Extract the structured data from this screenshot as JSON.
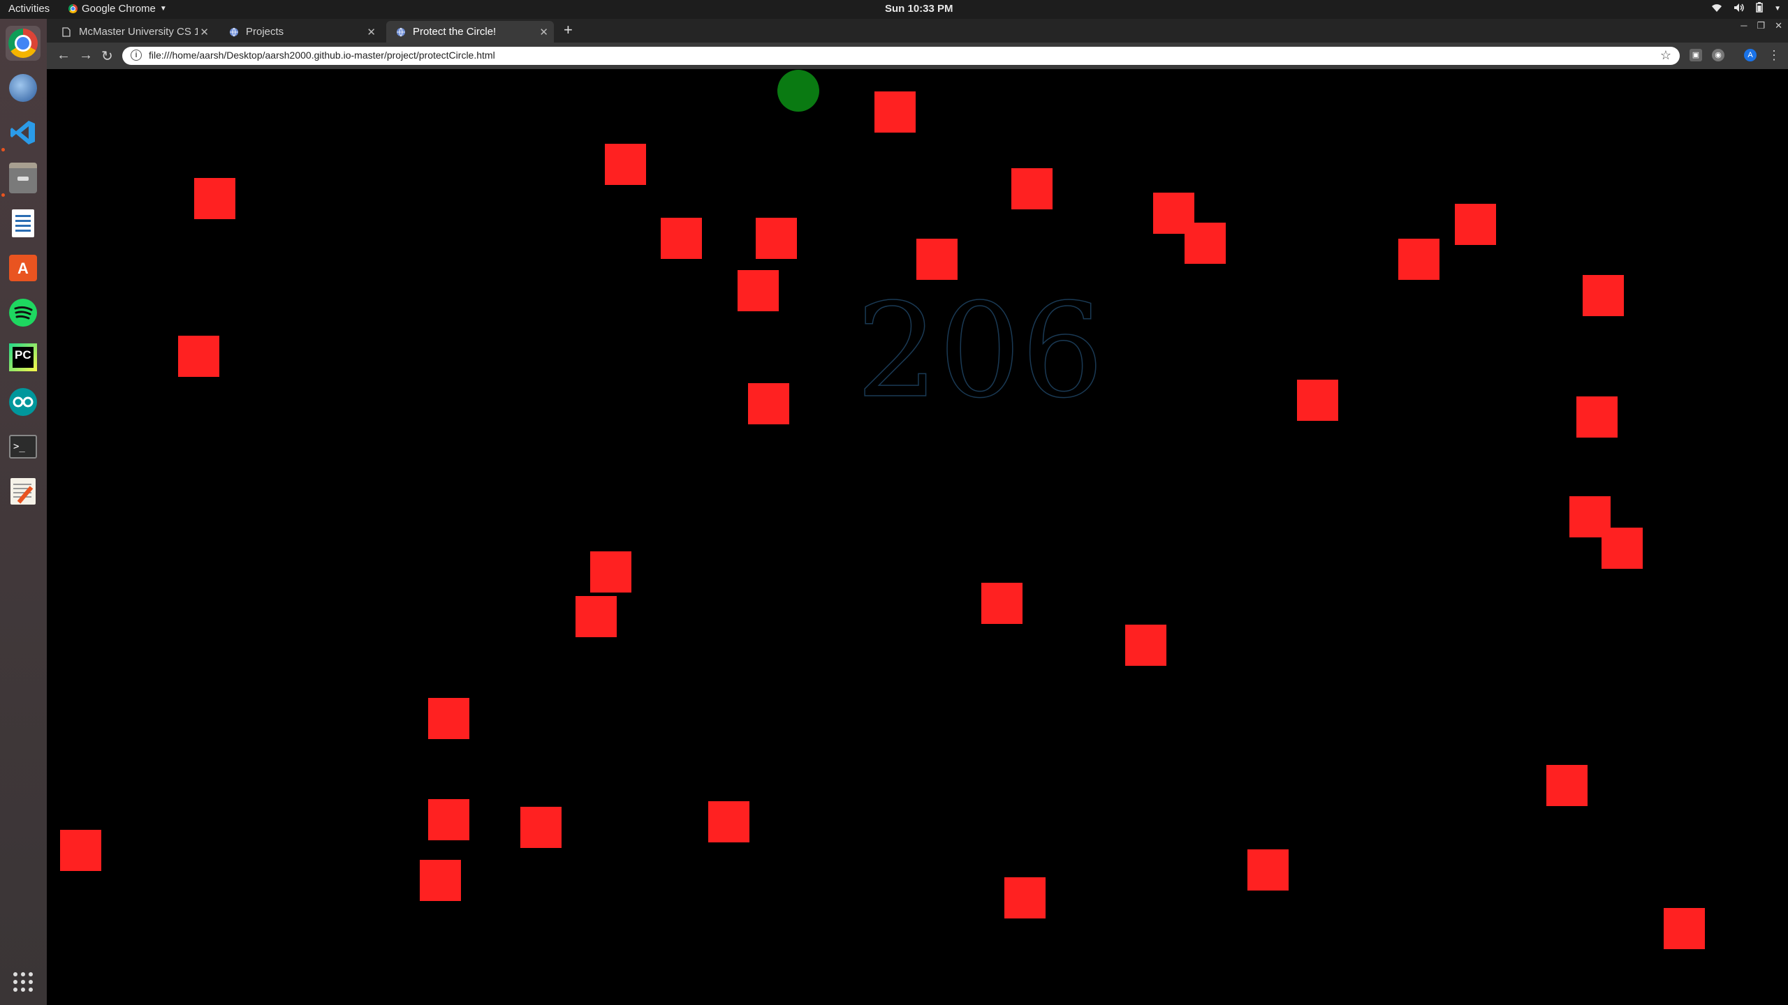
{
  "topbar": {
    "activities": "Activities",
    "app_name": "Google Chrome",
    "clock": "Sun 10:33 PM"
  },
  "dock": {
    "items": [
      "chrome-icon",
      "thunderbird-icon",
      "vscode-icon",
      "files-icon",
      "writer-icon",
      "software-icon",
      "spotify-icon",
      "pycharm-icon",
      "arduino-icon",
      "terminal-icon",
      "text-editor-icon",
      "apps-grid-icon"
    ]
  },
  "browser": {
    "tabs": [
      {
        "label": "McMaster University CS 1"
      },
      {
        "label": "Projects"
      },
      {
        "label": "Protect the Circle!"
      }
    ],
    "url": "file:///home/aarsh/Desktop/aarsh2000.github.io-master/project/protectCircle.html",
    "profile_initial": "A"
  },
  "game": {
    "score": "206",
    "colors": {
      "background": "#000000",
      "player": "#0a7a12",
      "enemy": "#ff2121",
      "score_stroke": "#1a3a55"
    }
  }
}
